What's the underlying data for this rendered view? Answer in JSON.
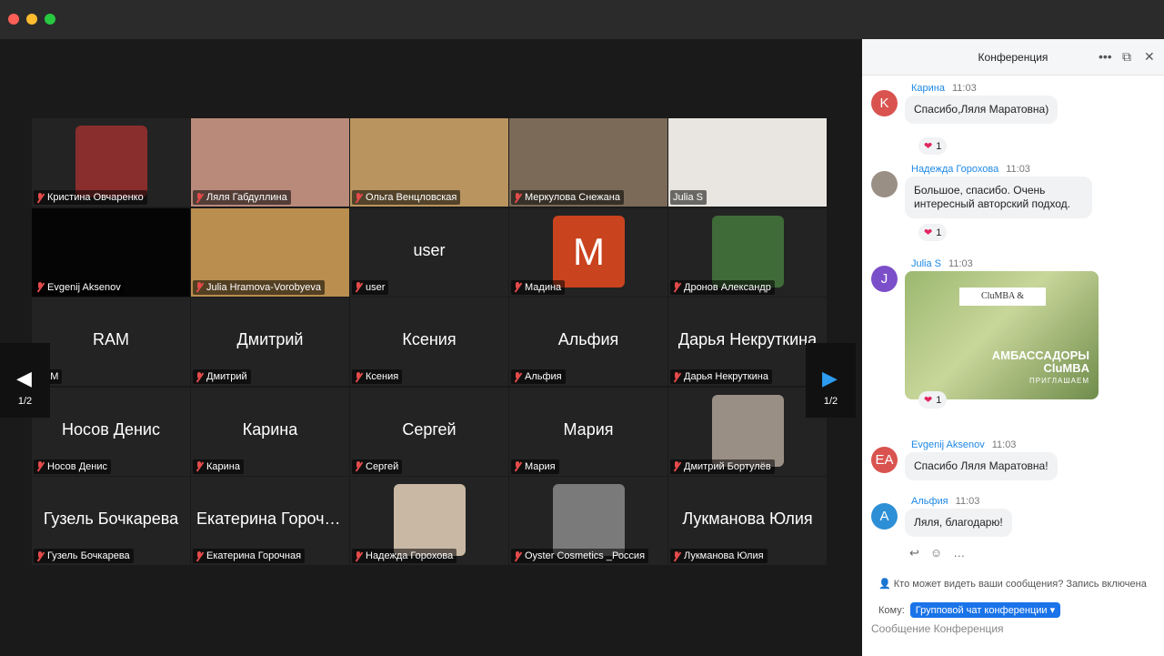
{
  "pager": {
    "left": "1/2",
    "right": "1/2"
  },
  "tiles": [
    {
      "big": "",
      "label": "Кристина Овчаренко",
      "photo": "#8a2d2d"
    },
    {
      "big": "",
      "label": "Ляля Габдуллина",
      "photo": "#b98a7a"
    },
    {
      "big": "",
      "label": "Ольга Венцловская",
      "photo": "#b9945e"
    },
    {
      "big": "",
      "label": "Меркулова Снежана",
      "photo": "#7a6a57"
    },
    {
      "big": "",
      "label": "Julia S",
      "photo": "#e9e6e1"
    },
    {
      "big": "",
      "label": "Evgenij Aksenov",
      "photo": "#050505"
    },
    {
      "big": "",
      "label": "Julia Hramova-Vorobyeva",
      "photo": "#b98e4f"
    },
    {
      "big": "user",
      "label": "user"
    },
    {
      "big": "M",
      "label": "Мадина"
    },
    {
      "big": "",
      "label": "Дронов Александр",
      "photo": "#3f6b39"
    },
    {
      "big": "RAM",
      "label": "RAM"
    },
    {
      "big": "Дмитрий",
      "label": "Дмитрий"
    },
    {
      "big": "Ксения",
      "label": "Ксения"
    },
    {
      "big": "Альфия",
      "label": "Альфия"
    },
    {
      "big": "Дарья Некруткина",
      "label": "Дарья Некруткина"
    },
    {
      "big": "Носов Денис",
      "label": "Носов Денис"
    },
    {
      "big": "Карина",
      "label": "Карина"
    },
    {
      "big": "Сергей",
      "label": "Сергей"
    },
    {
      "big": "Мария",
      "label": "Мария"
    },
    {
      "big": "",
      "label": "Дмитрий Бортулёв",
      "photo": "#9a8f85"
    },
    {
      "big": "Гузель Бочкарева",
      "label": "Гузель Бочкарева"
    },
    {
      "big": "Екатерина Горочная",
      "label": "Екатерина Горочная"
    },
    {
      "big": "",
      "label": "Надежда Горохова",
      "photo": "#c9b8a4"
    },
    {
      "big": "",
      "label": "Oyster Cosmetics _Россия",
      "photo": "#7a7a7a"
    },
    {
      "big": "Лукманова Юлия",
      "label": "Лукманова Юлия"
    }
  ],
  "chat": {
    "title": "Конференция",
    "messages": [
      {
        "initial": "K",
        "color": "#d9534f",
        "who": "Карина",
        "time": "11:03",
        "text": "Спасибо,Ляля Маратовна)",
        "react": "1"
      },
      {
        "initial": "",
        "color": "#9a8f85",
        "who": "Надежда Горохова",
        "time": "11:03",
        "text": "Большое, спасибо. Очень интересный авторский подход.",
        "react": "1"
      },
      {
        "initial": "J",
        "color": "#7b4fc9",
        "who": "Julia S",
        "time": "11:03",
        "image": {
          "brand": "CluMBA &",
          "line1": "АМБАССАДОРЫ",
          "line2": "CluMBA",
          "line3": "ПРИГЛАШАЕМ"
        },
        "react": "1"
      },
      {
        "initial": "EA",
        "color": "#d9534f",
        "who": "Evgenij Aksenov",
        "time": "11:03",
        "text": "Спасибо Ляля Маратовна!"
      },
      {
        "initial": "A",
        "color": "#2d8fd5",
        "who": "Альфия",
        "time": "11:03",
        "text": "Ляля, благодарю!"
      }
    ],
    "privacy_note": "Кто может видеть ваши сообщения? Запись включена",
    "to_label": "Кому:",
    "to_value": "Групповой чат конференции",
    "compose_placeholder": "Сообщение Конференция"
  }
}
